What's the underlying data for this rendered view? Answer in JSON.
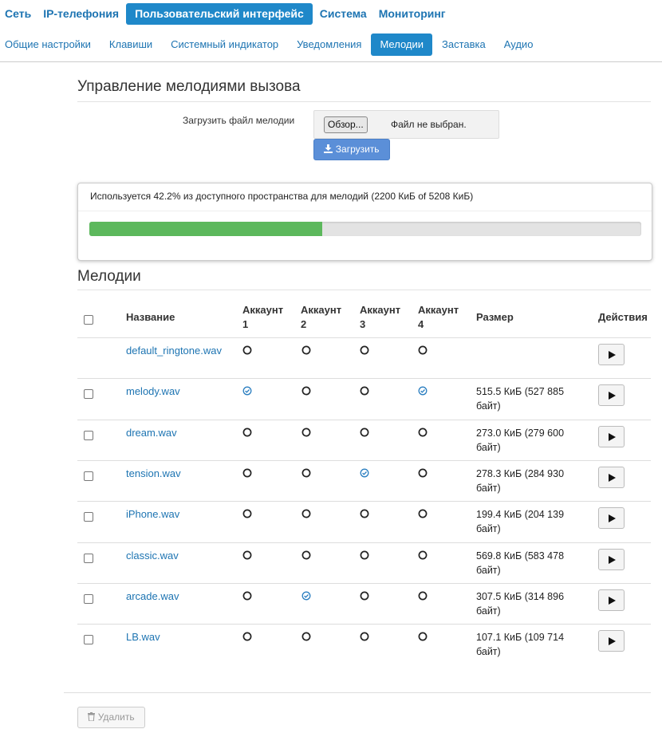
{
  "nav_primary": [
    {
      "label": "Сеть",
      "active": false
    },
    {
      "label": "IP-телефония",
      "active": false
    },
    {
      "label": "Пользовательский интерфейс",
      "active": true
    },
    {
      "label": "Система",
      "active": false
    },
    {
      "label": "Мониторинг",
      "active": false
    }
  ],
  "nav_secondary": [
    {
      "label": "Общие настройки",
      "active": false
    },
    {
      "label": "Клавиши",
      "active": false
    },
    {
      "label": "Системный индикатор",
      "active": false
    },
    {
      "label": "Уведомления",
      "active": false
    },
    {
      "label": "Мелодии",
      "active": true
    },
    {
      "label": "Заставка",
      "active": false
    },
    {
      "label": "Аудио",
      "active": false
    }
  ],
  "management": {
    "title": "Управление мелодиями вызова",
    "upload_label": "Загрузить файл мелодии",
    "browse_button": "Обзор...",
    "file_status": "Файл не выбран.",
    "upload_button": "Загрузить"
  },
  "usage": {
    "text": "Используется 42.2% из доступного пространства для мелодий (2200 КиБ of 5208 КиБ)",
    "percent": 42.2
  },
  "melodies": {
    "title": "Мелодии",
    "columns": {
      "name": "Название",
      "accounts": [
        "Аккаунт 1",
        "Аккаунт 2",
        "Аккаунт 3",
        "Аккаунт 4"
      ],
      "size": "Размер",
      "actions": "Действия"
    },
    "rows": [
      {
        "name": "default_ringtone.wav",
        "selectable": false,
        "accounts": [
          false,
          false,
          false,
          false
        ],
        "size": ""
      },
      {
        "name": "melody.wav",
        "selectable": true,
        "accounts": [
          true,
          false,
          false,
          true
        ],
        "size": "515.5 КиБ (527 885 байт)"
      },
      {
        "name": "dream.wav",
        "selectable": true,
        "accounts": [
          false,
          false,
          false,
          false
        ],
        "size": "273.0 КиБ (279 600 байт)"
      },
      {
        "name": "tension.wav",
        "selectable": true,
        "accounts": [
          false,
          false,
          true,
          false
        ],
        "size": "278.3 КиБ (284 930 байт)"
      },
      {
        "name": "iPhone.wav",
        "selectable": true,
        "accounts": [
          false,
          false,
          false,
          false
        ],
        "size": "199.4 КиБ (204 139 байт)"
      },
      {
        "name": "classic.wav",
        "selectable": true,
        "accounts": [
          false,
          false,
          false,
          false
        ],
        "size": "569.8 КиБ (583 478 байт)"
      },
      {
        "name": "arcade.wav",
        "selectable": true,
        "accounts": [
          false,
          true,
          false,
          false
        ],
        "size": "307.5 КиБ (314 896 байт)"
      },
      {
        "name": "LB.wav",
        "selectable": true,
        "accounts": [
          false,
          false,
          false,
          false
        ],
        "size": "107.1 КиБ (109 714 байт)"
      }
    ],
    "delete_button": "Удалить"
  },
  "icons": {
    "upload": "download-icon",
    "delete": "trash-icon",
    "play": "play-icon",
    "account_on": "radio-checked-icon",
    "account_off": "radio-unchecked-icon"
  },
  "colors": {
    "accent": "#1f88c9",
    "link": "#1d74b2",
    "upload_button": "#5b8fd8",
    "progress": "#5cb85c",
    "checked": "#2a7ec0"
  }
}
